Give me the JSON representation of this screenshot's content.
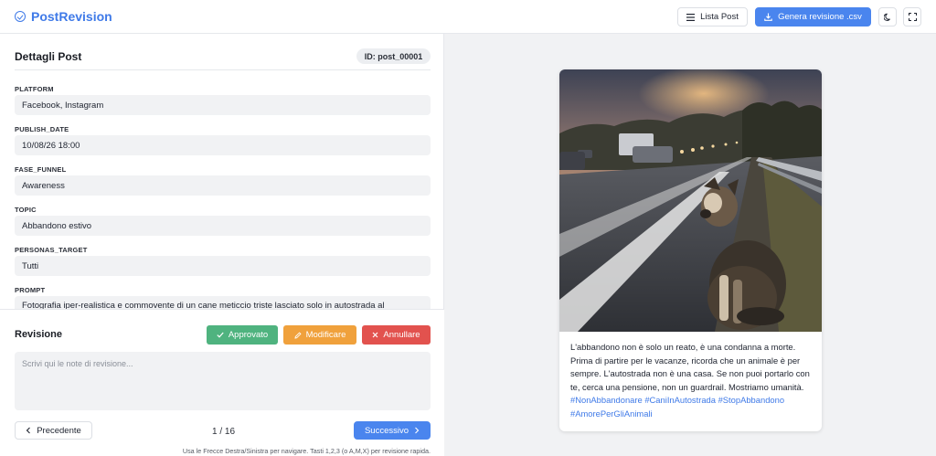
{
  "app": {
    "name": "PostRevision"
  },
  "toolbar": {
    "list_label": "Lista Post",
    "generate_label": "Genera revisione .csv",
    "theme_icon": "moon-icon",
    "fullscreen_icon": "expand-icon"
  },
  "details": {
    "title": "Dettagli Post",
    "id_badge": "ID: post_00001",
    "fields": [
      {
        "label": "PLATFORM",
        "value": "Facebook, Instagram"
      },
      {
        "label": "PUBLISH_DATE",
        "value": "10/08/26 18:00"
      },
      {
        "label": "FASE_FUNNEL",
        "value": "Awareness"
      },
      {
        "label": "TOPIC",
        "value": "Abbandono estivo"
      },
      {
        "label": "PERSONAS_TARGET",
        "value": "Tutti"
      },
      {
        "label": "PROMPT",
        "value": "Fotografia iper-realistica e commovente di un cane meticcio triste lasciato solo in autostrada al"
      }
    ]
  },
  "review": {
    "title": "Revisione",
    "approve_label": "Approvato",
    "modify_label": "Modificare",
    "cancel_label": "Annullare",
    "notes_placeholder": "Scrivi qui le note di revisione...",
    "prev_label": "Precedente",
    "next_label": "Successivo",
    "pager": "1 / 16",
    "hint": "Usa le Frecce Destra/Sinistra per navigare. Tasti 1,2,3 (o A,M,X) per revisione rapida."
  },
  "preview": {
    "caption_text": "L'abbandono non è solo un reato, è una condanna a morte. Prima di partire per le vacanze, ricorda che un animale è per sempre. L'autostrada non è una casa. Se non puoi portarlo con te, cerca una pensione, non un guardrail. Mostriamo umanità.",
    "hashtags": [
      "#NonAbbandonare",
      "#CaniInAutostrada",
      "#StopAbbandono",
      "#AmorePerGliAnimali"
    ]
  },
  "colors": {
    "accent": "#3f7ae8",
    "approve": "#4fb37f",
    "modify": "#f0a13c",
    "cancel": "#e2524e"
  }
}
